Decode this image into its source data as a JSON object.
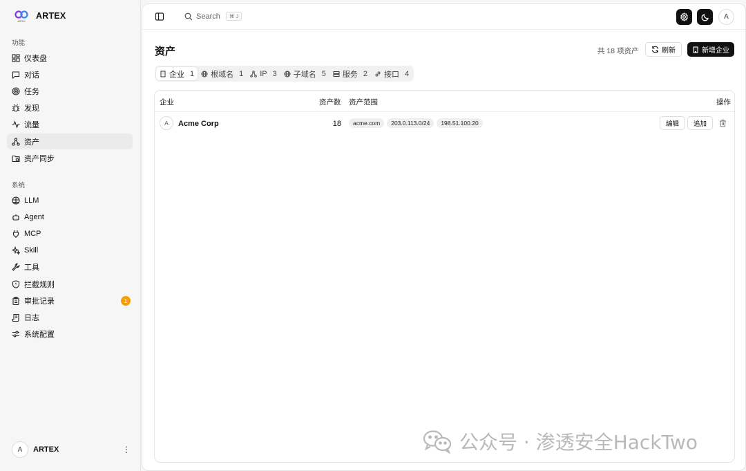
{
  "brand": {
    "name": "ARTEX",
    "logo_sub": "ARTEX"
  },
  "sidebar": {
    "section1": "功能",
    "items1": [
      {
        "label": "仪表盘",
        "icon": "dashboard-icon"
      },
      {
        "label": "对话",
        "icon": "chat-icon"
      },
      {
        "label": "任务",
        "icon": "target-icon"
      },
      {
        "label": "发现",
        "icon": "bug-icon"
      },
      {
        "label": "流量",
        "icon": "activity-icon"
      },
      {
        "label": "资产",
        "icon": "network-icon",
        "active": true
      },
      {
        "label": "资产同步",
        "icon": "folder-sync-icon"
      }
    ],
    "section2": "系统",
    "items2": [
      {
        "label": "LLM",
        "icon": "brain-icon"
      },
      {
        "label": "Agent",
        "icon": "bot-icon"
      },
      {
        "label": "MCP",
        "icon": "plug-icon"
      },
      {
        "label": "Skill",
        "icon": "sparkles-icon"
      },
      {
        "label": "工具",
        "icon": "wrench-icon"
      },
      {
        "label": "拦截规则",
        "icon": "shield-icon"
      },
      {
        "label": "审批记录",
        "icon": "clipboard-icon",
        "badge": "1"
      },
      {
        "label": "日志",
        "icon": "scroll-icon"
      },
      {
        "label": "系统配置",
        "icon": "settings-sliders-icon"
      }
    ],
    "user": {
      "initial": "A",
      "name": "ARTEX"
    }
  },
  "topbar": {
    "search_placeholder": "Search",
    "shortcut": "⌘ J",
    "avatar": "A"
  },
  "page": {
    "title": "资产",
    "count_text": "共 18 项资产",
    "refresh_label": "刷新",
    "new_label": "新增企业"
  },
  "tabs": [
    {
      "label": "企业",
      "count": "1",
      "active": true
    },
    {
      "label": "根域名",
      "count": "1"
    },
    {
      "label": "IP",
      "count": "3"
    },
    {
      "label": "子域名",
      "count": "5"
    },
    {
      "label": "服务",
      "count": "2"
    },
    {
      "label": "接口",
      "count": "4"
    }
  ],
  "table": {
    "headers": {
      "company": "企业",
      "count": "资产数",
      "scope": "资产范围",
      "actions": "操作"
    },
    "rows": [
      {
        "initial": "A",
        "name": "Acme Corp",
        "count": "18",
        "scope": [
          "acme.com",
          "203.0.113.0/24",
          "198.51.100.20"
        ],
        "edit": "编辑",
        "add": "追加"
      }
    ]
  },
  "watermark": "公众号 · 渗透安全HackTwo",
  "colors": {
    "badge": "#f59e0b",
    "primary": "#111111"
  }
}
